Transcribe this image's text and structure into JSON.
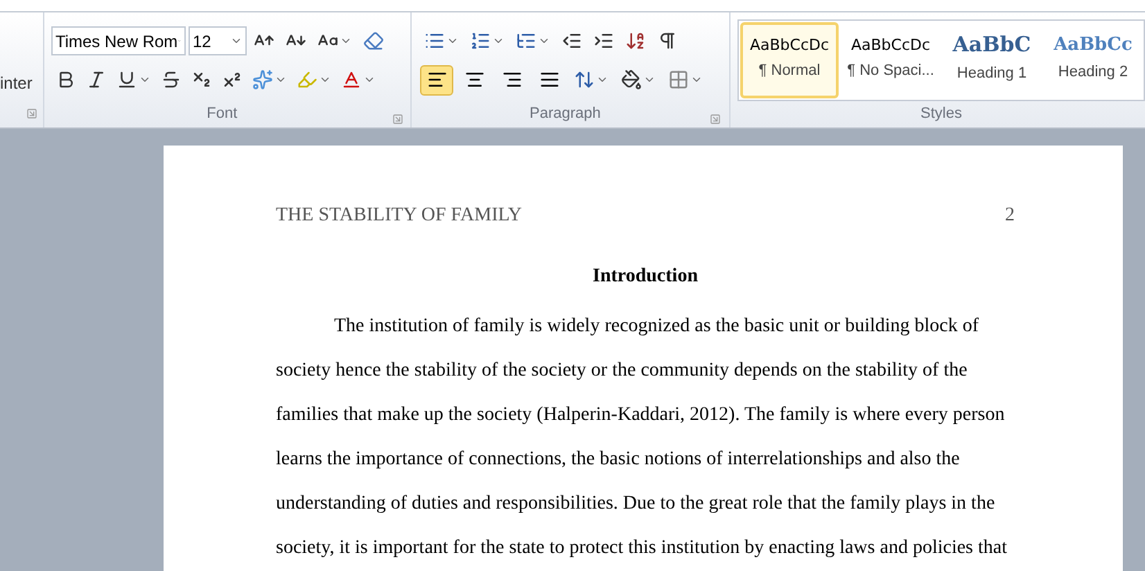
{
  "ribbon": {
    "clipboard": {
      "label_fragment": "inter"
    },
    "font": {
      "font_name": "Times New Rom",
      "font_size": "12",
      "group_label": "Font"
    },
    "paragraph": {
      "group_label": "Paragraph",
      "alignment": [
        {
          "kind": "left",
          "selected": true
        },
        {
          "kind": "center",
          "selected": false
        },
        {
          "kind": "right",
          "selected": false
        },
        {
          "kind": "justify",
          "selected": false
        }
      ]
    },
    "styles": {
      "group_label": "Styles",
      "items": [
        {
          "preview": "AaBbCcDc",
          "name": "¶ Normal",
          "kind": "normal",
          "selected": true
        },
        {
          "preview": "AaBbCcDc",
          "name": "¶ No Spaci...",
          "kind": "normal",
          "selected": false
        },
        {
          "preview": "AaBbC",
          "name": "Heading 1",
          "kind": "heading1",
          "selected": false
        },
        {
          "preview": "AaBbCc",
          "name": "Heading 2",
          "kind": "heading2",
          "selected": false
        }
      ]
    }
  },
  "document": {
    "running_head": "THE STABILITY OF FAMILY",
    "page_number": "2",
    "heading": "Introduction",
    "lines": [
      "The institution of family is widely recognized as the basic unit or building block of",
      "society hence the stability of the society or the community depends on the stability of the",
      "families that make up the society (Halperin-Kaddari, 2012). The family is where every person",
      "learns the importance of connections, the basic notions of interrelationships and also the",
      "understanding of duties and responsibilities. Due to the great role that the family plays in the",
      "society, it is important for the state to protect this institution by enacting laws and policies that"
    ]
  }
}
